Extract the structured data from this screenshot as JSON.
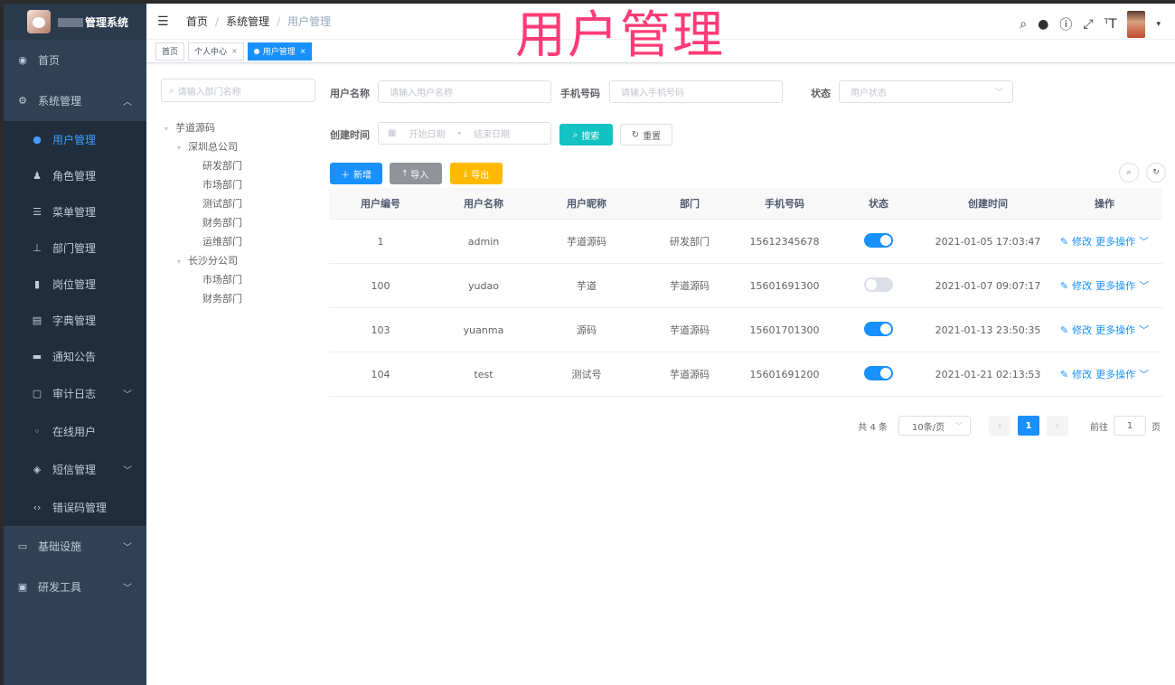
{
  "app": {
    "title": "管理系统"
  },
  "watermark": "用户管理",
  "sidebar": {
    "items": [
      {
        "label": "首页",
        "icon": "dashboard-icon"
      },
      {
        "label": "系统管理",
        "icon": "gear-icon"
      }
    ],
    "sub_items": [
      {
        "label": "用户管理",
        "icon": "user-icon"
      },
      {
        "label": "角色管理",
        "icon": "peoples-icon"
      },
      {
        "label": "菜单管理",
        "icon": "tree-table-icon"
      },
      {
        "label": "部门管理",
        "icon": "tree-icon"
      },
      {
        "label": "岗位管理",
        "icon": "post-icon"
      },
      {
        "label": "字典管理",
        "icon": "dict-icon"
      },
      {
        "label": "通知公告",
        "icon": "message-icon"
      },
      {
        "label": "审计日志",
        "icon": "log-icon"
      },
      {
        "label": "在线用户",
        "icon": "online-icon"
      },
      {
        "label": "短信管理",
        "icon": "validcode-icon"
      },
      {
        "label": "错误码管理",
        "icon": "code-icon"
      }
    ],
    "bottom_items": [
      {
        "label": "基础设施",
        "icon": "monitor-icon"
      },
      {
        "label": "研发工具",
        "icon": "tool-icon"
      }
    ]
  },
  "navbar": {
    "breadcrumb": [
      "首页",
      "系统管理",
      "用户管理"
    ],
    "separator": "/"
  },
  "tags": [
    {
      "label": "首页"
    },
    {
      "label": "个人中心"
    },
    {
      "label": "用户管理"
    }
  ],
  "tree": {
    "search_placeholder": "请输入部门名称",
    "nodes": [
      "芋道源码",
      "深圳总公司",
      "研发部门",
      "市场部门",
      "测试部门",
      "财务部门",
      "运维部门",
      "长沙分公司",
      "市场部门",
      "财务部门"
    ]
  },
  "query": {
    "username_label": "用户名称",
    "username_placeholder": "请输入用户名称",
    "mobile_label": "手机号码",
    "mobile_placeholder": "请输入手机号码",
    "status_label": "状态",
    "status_placeholder": "用户状态",
    "time_label": "创建时间",
    "start_placeholder": "开始日期",
    "range_sep": "-",
    "end_placeholder": "结束日期",
    "search_label": "搜索",
    "reset_label": "重置"
  },
  "toolbar": {
    "add_label": "新增",
    "import_label": "导入",
    "export_label": "导出"
  },
  "table": {
    "columns": [
      "用户编号",
      "用户名称",
      "用户昵称",
      "部门",
      "手机号码",
      "状态",
      "创建时间",
      "操作"
    ],
    "rows": [
      {
        "id": "1",
        "username": "admin",
        "nickname": "芋道源码",
        "dept": "研发部门",
        "mobile": "15612345678",
        "status": true,
        "created": "2021-01-05 17:03:47"
      },
      {
        "id": "100",
        "username": "yudao",
        "nickname": "芋道",
        "dept": "芋道源码",
        "mobile": "15601691300",
        "status": false,
        "created": "2021-01-07 09:07:17"
      },
      {
        "id": "103",
        "username": "yuanma",
        "nickname": "源码",
        "dept": "芋道源码",
        "mobile": "15601701300",
        "status": true,
        "created": "2021-01-13 23:50:35"
      },
      {
        "id": "104",
        "username": "test",
        "nickname": "测试号",
        "dept": "芋道源码",
        "mobile": "15601691200",
        "status": true,
        "created": "2021-01-21 02:13:53"
      }
    ],
    "edit_label": "修改",
    "more_label": "更多操作"
  },
  "pagination": {
    "total": "共 4 条",
    "page_size": "10条/页",
    "current": "1",
    "goto_label": "前往",
    "goto_value": "1",
    "page_unit": "页"
  },
  "colors": {
    "primary": "#1890ff",
    "sidebar_bg": "#304156",
    "watermark": "#ff3b77"
  }
}
